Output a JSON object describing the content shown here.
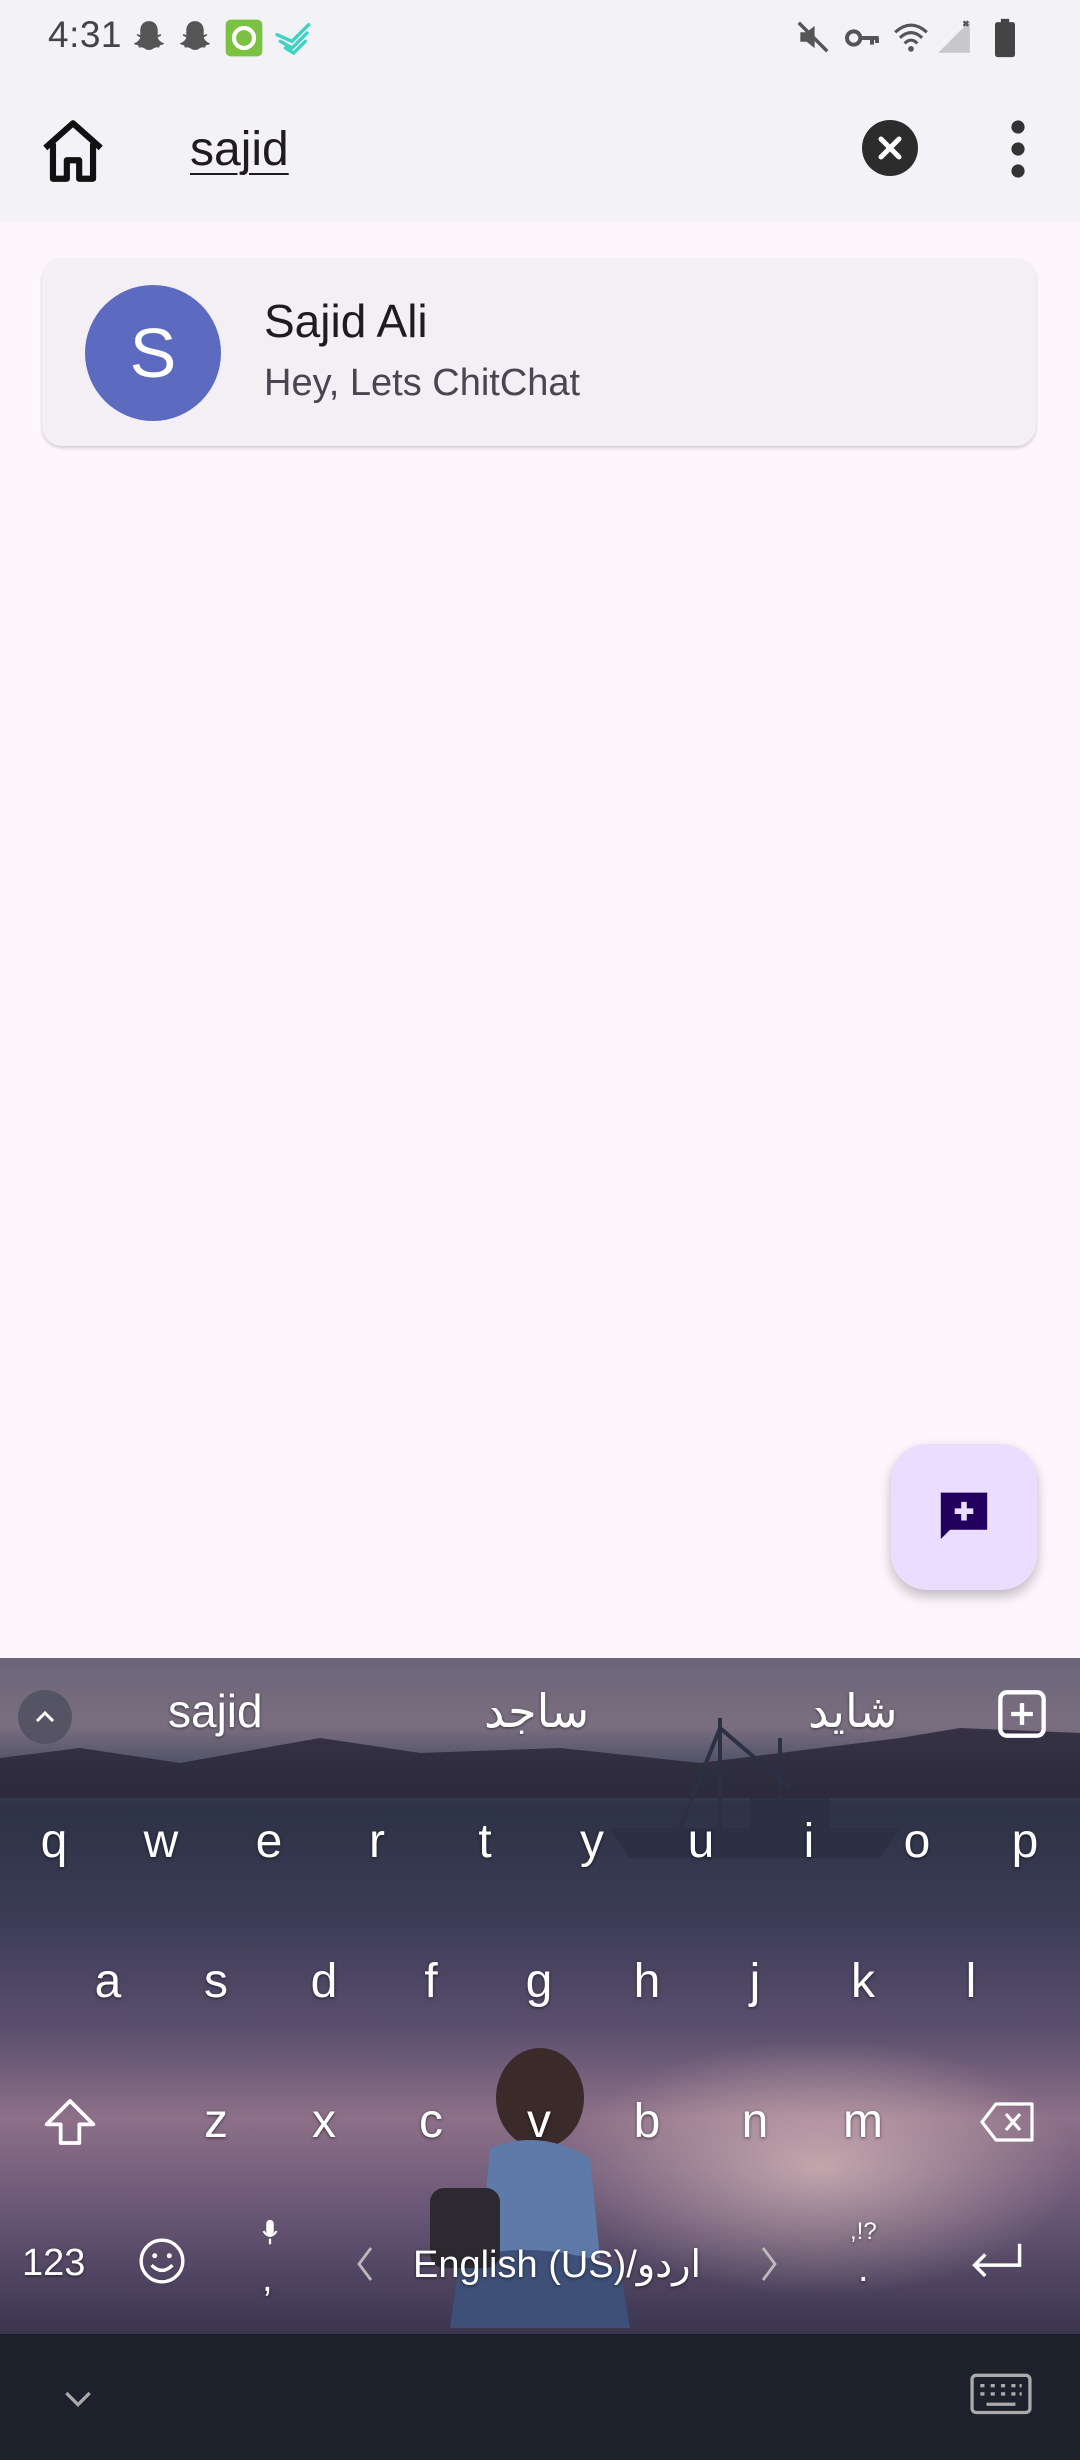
{
  "status_bar": {
    "time": "4:31",
    "left_icons": [
      "snapchat-icon",
      "snapchat-icon",
      "green-app-icon",
      "bird-app-icon"
    ],
    "right_icons": [
      "mute-icon",
      "vpn-key-icon",
      "wifi-icon",
      "signal-icon",
      "battery-icon"
    ]
  },
  "app_bar": {
    "search_value": "sajid",
    "icons": {
      "home": "home-icon",
      "clear": "close-icon",
      "more": "more-vert-icon"
    }
  },
  "results": [
    {
      "avatar_letter": "S",
      "avatar_color": "#5c6bc0",
      "name": "Sajid Ali",
      "status": "Hey, Lets ChitChat"
    }
  ],
  "fab": {
    "icon": "add-comment-icon",
    "color": "#ebddff",
    "icon_color": "#21005d"
  },
  "keyboard": {
    "suggestions": [
      "sajid",
      "ساجد",
      "شاید"
    ],
    "rows": [
      [
        "q",
        "w",
        "e",
        "r",
        "t",
        "y",
        "u",
        "i",
        "o",
        "p"
      ],
      [
        "a",
        "s",
        "d",
        "f",
        "g",
        "h",
        "j",
        "k",
        "l"
      ],
      [
        "z",
        "x",
        "c",
        "v",
        "b",
        "n",
        "m"
      ]
    ],
    "symbols_key": "123",
    "comma_key": ",",
    "space_label": "English (US)/اردو",
    "period_key": ".",
    "punct_hint": ",!?"
  }
}
